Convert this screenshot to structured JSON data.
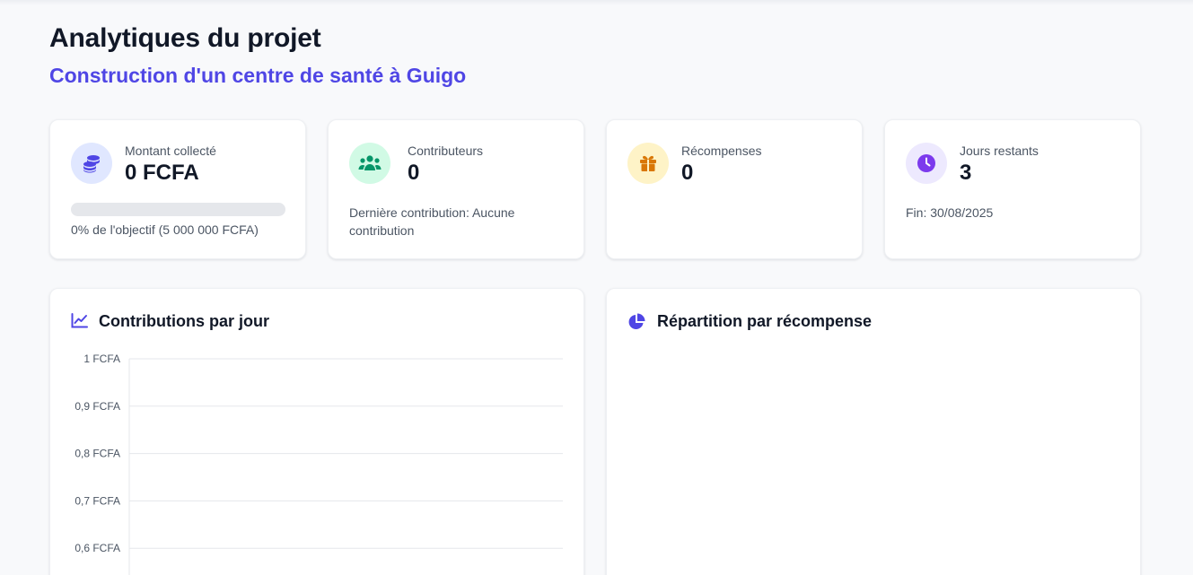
{
  "page": {
    "title": "Analytiques du projet",
    "subtitle": "Construction d'un centre de santé à Guigo"
  },
  "stats": {
    "amount": {
      "label": "Montant collecté",
      "value": "0 FCFA",
      "progress_percent": 0,
      "note": "0% de l'objectif (5 000 000 FCFA)",
      "icon": "coins-icon",
      "color": "#4f46e5",
      "bg": "#e0e7ff"
    },
    "contributors": {
      "label": "Contributeurs",
      "value": "0",
      "note": "Dernière contribution: Aucune contribution",
      "icon": "users-icon",
      "color": "#059669",
      "bg": "#d1fae5"
    },
    "rewards": {
      "label": "Récompenses",
      "value": "0",
      "icon": "gift-icon",
      "color": "#d97706",
      "bg": "#fef3c7"
    },
    "days": {
      "label": "Jours restants",
      "value": "3",
      "note": "Fin: 30/08/2025",
      "icon": "clock-icon",
      "color": "#7c3aed",
      "bg": "#ede9fe"
    }
  },
  "panels": {
    "daily": {
      "title": "Contributions par jour",
      "icon": "line-chart-icon"
    },
    "rewards": {
      "title": "Répartition par récompense",
      "icon": "pie-chart-icon"
    }
  },
  "chart_data": {
    "type": "line",
    "title": "Contributions par jour",
    "xlabel": "",
    "ylabel": "",
    "x": [],
    "series": [],
    "ytick_labels": [
      "1 FCFA",
      "0,9 FCFA",
      "0,8 FCFA",
      "0,7 FCFA",
      "0,6 FCFA"
    ],
    "ylim": [
      0,
      1
    ],
    "grid": true
  },
  "colors": {
    "accent": "#4f46e5",
    "grid": "#e5e7eb"
  }
}
